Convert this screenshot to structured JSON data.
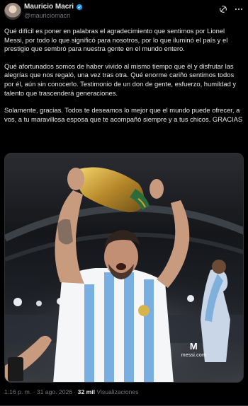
{
  "tweet": {
    "author_name": "Mauricio Macri",
    "author_handle": "@mauriciomacri",
    "paragraphs": [
      "Qué difícil es poner en palabras el agradecimiento que sentimos por Lionel Messi, por todo lo que significó para nosotros, por lo que iluminó el país y el prestigio que sembró para nuestra gente en el mundo entero.",
      "Qué afortunados somos de haber vivido al mismo tiempo que él y disfrutar las alegrías que nos regaló, una vez tras otra. Qué enorme cariño sentimos todos por él, aún sin conocerlo. Testimonio de un don de gente, esfuerzo, humildad y talento que trascenderá generaciones.",
      "Solamente, gracias. Todos te deseamos lo mejor que el mundo puede ofrecer, a vos, a tu maravillosa esposa que te acompañó siempre y a tus chicos. GRACIAS"
    ],
    "media_watermark": "messi.com",
    "timestamp": "1:16 p. m. · 31 ago. 2026 · ",
    "views_count": "32 mil",
    "views_label": " Visualizaciones"
  },
  "icons": {
    "verified": "verified-badge-icon",
    "grok": "grok-icon",
    "more": "more-icon"
  },
  "colors": {
    "background": "#000000",
    "text": "#e7e9ea",
    "secondary": "#71767b",
    "verified": "#1d9bf0"
  }
}
